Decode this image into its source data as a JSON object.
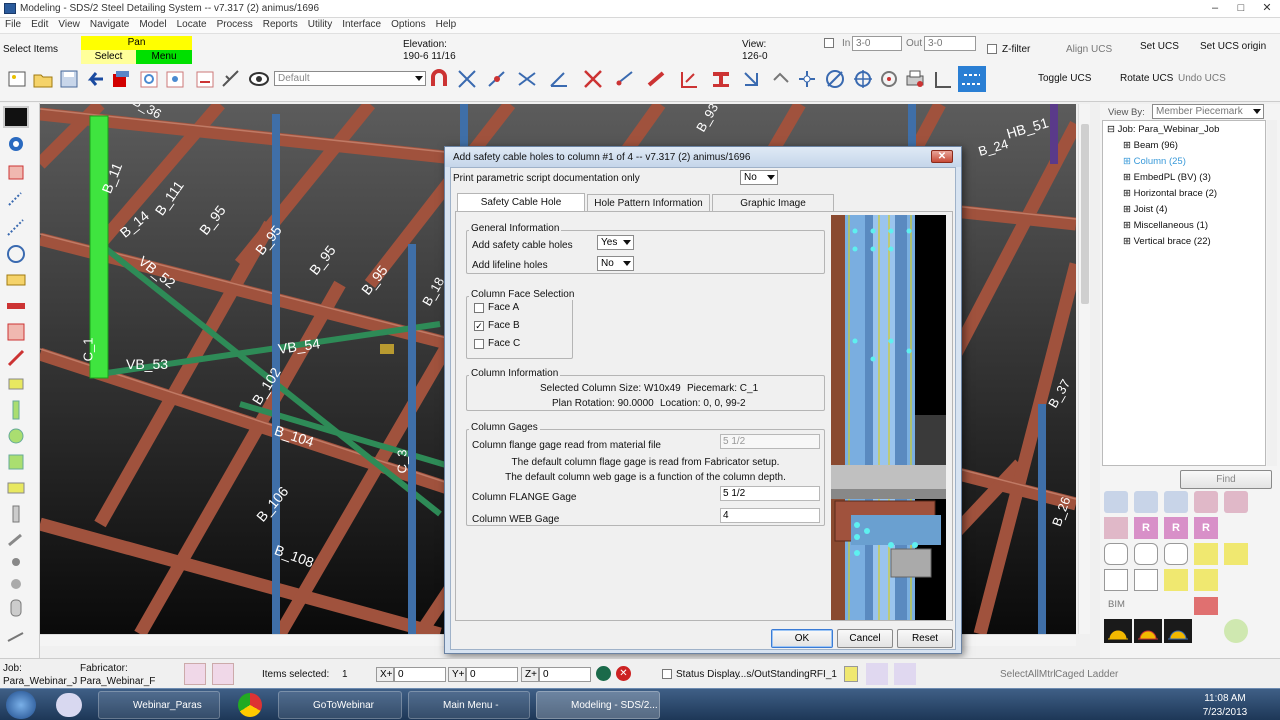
{
  "window": {
    "title": "Modeling - SDS/2 Steel Detailing System  --  v7.317  (2) animus/1696",
    "min": "–",
    "max": "□",
    "close": "✕"
  },
  "menu": [
    "File",
    "Edit",
    "View",
    "Navigate",
    "Model",
    "Locate",
    "Process",
    "Reports",
    "Utility",
    "Interface",
    "Options",
    "Help"
  ],
  "toolbar": {
    "select_items": "Select Items",
    "pan": "Pan",
    "select": "Select",
    "menu": "Menu",
    "elevation_label": "Elevation:",
    "elevation_value": "190-6 11/16",
    "view_label": "View:",
    "view_value": "126-0",
    "in_label": "In",
    "in_value": "3-0",
    "out_label": "Out",
    "out_value": "3-0",
    "zfilter": "Z-filter",
    "align_ucs": "Align UCS",
    "set_ucs": "Set UCS",
    "set_ucs_origin": "Set UCS origin",
    "toggle_ucs": "Toggle UCS",
    "rotate_ucs": "Rotate UCS",
    "undo_ucs": "Undo UCS",
    "default_combo": "Default"
  },
  "model_labels": {
    "b36": "B_36",
    "b11": "B_11",
    "b111": "B_111",
    "b14": "B_14",
    "b95a": "B_95",
    "b95b": "B_95",
    "b95c": "B_95",
    "b95d": "B_95",
    "vb52": "VB_52",
    "vb53": "VB_53",
    "vb54": "VB_54",
    "b102": "B_102",
    "b104": "B_104",
    "b106": "B_106",
    "b108": "B_108",
    "c1": "C_1",
    "c3": "C_3",
    "b18": "B_18",
    "hb51": "HB_51",
    "b24": "B_24",
    "b37": "B_37",
    "b26": "B_26",
    "b93": "B_93"
  },
  "right_panel": {
    "view_by_label": "View By:",
    "view_by_value": "Member Piecemark",
    "root": "Job: Para_Webinar_Job",
    "items": [
      {
        "label": "Beam (96)",
        "highlight": false
      },
      {
        "label": "Column (25)",
        "highlight": true
      },
      {
        "label": "EmbedPL (BV) (3)",
        "highlight": false
      },
      {
        "label": "Horizontal brace (2)",
        "highlight": false
      },
      {
        "label": "Joist (4)",
        "highlight": false
      },
      {
        "label": "Miscellaneous (1)",
        "highlight": false
      },
      {
        "label": "Vertical brace (22)",
        "highlight": false
      }
    ],
    "find": "Find",
    "bim": "BIM"
  },
  "dialog": {
    "title": "Add safety cable holes to column #1 of 4  --  v7.317  (2) animus/1696",
    "print_label": "Print parametric script documentation only",
    "print_value": "No",
    "tabs": [
      "Safety Cable Hole information",
      "Hole Pattern Information",
      "Graphic Image"
    ],
    "general": {
      "title": "General Information",
      "add_safety_label": "Add safety cable holes",
      "add_safety_value": "Yes",
      "add_lifeline_label": "Add lifeline holes",
      "add_lifeline_value": "No"
    },
    "faces": {
      "title": "Column Face Selection",
      "items": [
        {
          "label": "Face A",
          "checked": false,
          "mark": ""
        },
        {
          "label": "Face B",
          "checked": true,
          "mark": "✓"
        },
        {
          "label": "Face C",
          "checked": false,
          "mark": ""
        }
      ]
    },
    "column_info": {
      "title": "Column Information",
      "size": "Selected Column Size: W10x49",
      "piecemark": "Piecemark: C_1",
      "rotation": "Plan Rotation: 90.0000",
      "location": "Location: 0, 0, 99-2"
    },
    "gages": {
      "title": "Column Gages",
      "flange_from_file_label": "Column flange gage read from material file",
      "flange_from_file_value": "5 1/2",
      "note1": "The default column flage gage is read from Fabricator setup.",
      "note2": "The default column web gage is a function of the column depth.",
      "flange_label": "Column FLANGE Gage",
      "flange_value": "5 1/2",
      "web_label": "Column WEB Gage",
      "web_value": "4"
    },
    "buttons": {
      "ok": "OK",
      "cancel": "Cancel",
      "reset": "Reset"
    }
  },
  "status": {
    "job_label": "Job:",
    "job_value": "Para_Webinar_J",
    "fab_label": "Fabricator:",
    "fab_value": "Para_Webinar_F",
    "items_selected_label": "Items selected:",
    "items_selected_value": "1",
    "x_label": "X+",
    "x_value": "0",
    "y_label": "Y+",
    "y_value": "0",
    "z_label": "Z+",
    "z_value": "0",
    "status_display": "Status Display",
    "rfi": "...s/OutStandingRFI_1",
    "select_all": "SelectAllMtrl",
    "caged_ladder": "Caged Ladder"
  },
  "taskbar": {
    "items": [
      "Webinar_Paras",
      "GoToWebinar",
      "Main Menu - SDS...",
      "Modeling - SDS/2..."
    ],
    "time": "11:08 AM",
    "date": "7/23/2013"
  },
  "colors": {
    "highlight_blue": "#3a9ad9",
    "pan_yellow": "#ffff00",
    "menu_green": "#00e000",
    "beam_red": "#a0523d",
    "brace_green": "#2e8b57"
  }
}
